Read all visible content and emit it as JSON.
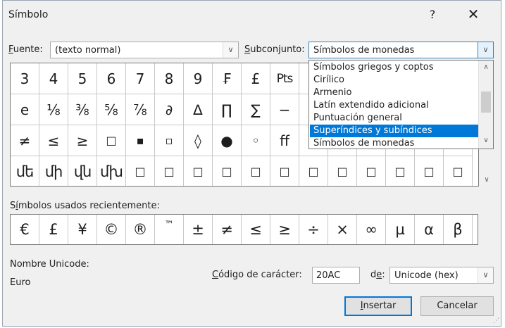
{
  "window": {
    "title": "Símbolo",
    "help_label": "?",
    "close_label": "✕"
  },
  "font_field": {
    "label_prefix": "",
    "label_key": "F",
    "label_rest": "uente:",
    "value": "(texto normal)"
  },
  "subset_field": {
    "label_key": "S",
    "label_rest": "ubconjunto:",
    "value": "Símbolos de monedas"
  },
  "subset_dropdown": {
    "items": [
      "Símbolos griegos y coptos",
      "Cirílico",
      "Armenio",
      "Latín extendido adicional",
      "Puntuación general",
      "Superíndices y subíndices",
      "Símbolos de monedas"
    ],
    "selected_index": 5
  },
  "symbol_grid": {
    "rows": [
      [
        "3",
        "4",
        "5",
        "6",
        "7",
        "8",
        "9",
        "₣",
        "£",
        "Pts",
        "",
        "",
        "",
        "",
        "",
        ""
      ],
      [
        "e",
        "⅛",
        "⅜",
        "⅝",
        "⅞",
        "∂",
        "∆",
        "∏",
        "∑",
        "−",
        "",
        "",
        "",
        "",
        "",
        ""
      ],
      [
        "≠",
        "≤",
        "≥",
        "□",
        "▪",
        "▫",
        "◊",
        "●",
        "◦",
        "ﬀ",
        "",
        "",
        "",
        "",
        "",
        ""
      ],
      [
        "մե",
        "մի",
        "վն",
        "մխ",
        "□",
        "□",
        "□",
        "□",
        "□",
        "□",
        "□",
        "□",
        "□",
        "□",
        "□",
        "□"
      ]
    ]
  },
  "recent": {
    "label_pre": "S",
    "label_key": "í",
    "label_rest": "mbolos usados recientemente:",
    "symbols": [
      "€",
      "£",
      "¥",
      "©",
      "®",
      "™",
      "±",
      "≠",
      "≤",
      "≥",
      "÷",
      "×",
      "∞",
      "µ",
      "α",
      "β"
    ]
  },
  "unicode_name": {
    "label": "Nombre Unicode:",
    "value": "Euro"
  },
  "char_code": {
    "label_key": "C",
    "label_rest": "ódigo de carácter:",
    "value": "20AC"
  },
  "from_field": {
    "label_pre": "d",
    "label_key": "e",
    "label_rest": ":",
    "value": "Unicode (hex)"
  },
  "buttons": {
    "insert_key": "I",
    "insert_rest": "nsertar",
    "cancel": "Cancelar"
  },
  "icons": {
    "dropdown_arrow": "chevron-down-icon",
    "scroll_up": "chevron-up-icon"
  }
}
